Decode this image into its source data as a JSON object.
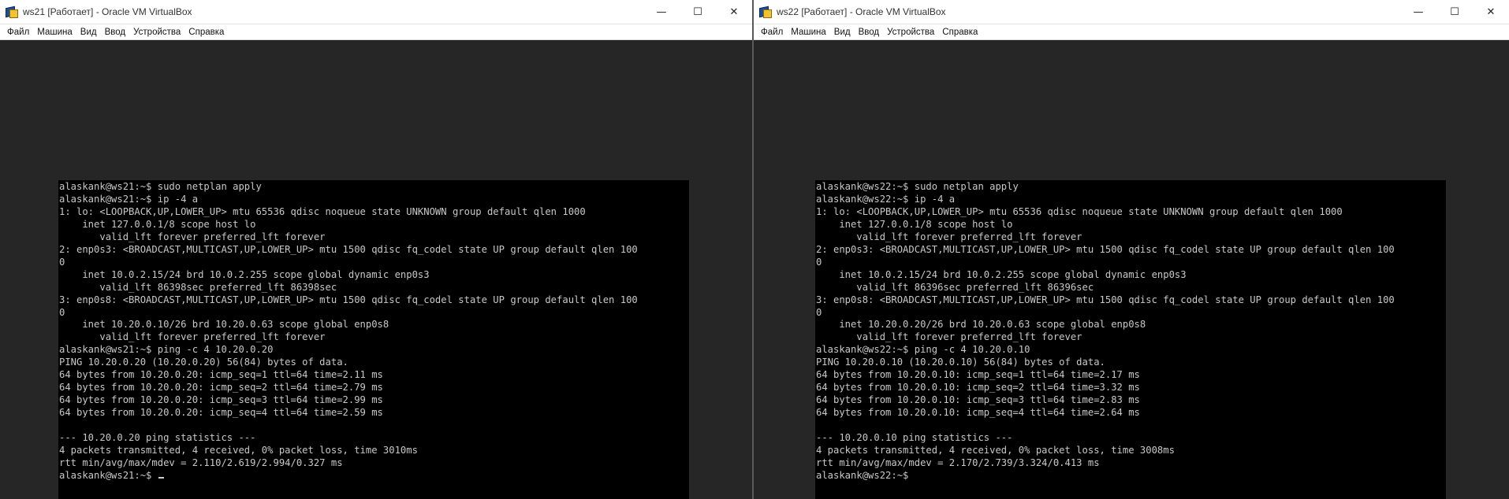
{
  "vms": [
    {
      "title": "ws21 [Работает] - Oracle VM VirtualBox",
      "menu": [
        "Файл",
        "Машина",
        "Вид",
        "Ввод",
        "Устройства",
        "Справка"
      ],
      "controls": {
        "minimize": "—",
        "maximize": "☐",
        "close": "✕"
      },
      "console_text": "alaskank@ws21:~$ sudo netplan apply\nalaskank@ws21:~$ ip -4 a\n1: lo: <LOOPBACK,UP,LOWER_UP> mtu 65536 qdisc noqueue state UNKNOWN group default qlen 1000\n    inet 127.0.0.1/8 scope host lo\n       valid_lft forever preferred_lft forever\n2: enp0s3: <BROADCAST,MULTICAST,UP,LOWER_UP> mtu 1500 qdisc fq_codel state UP group default qlen 100\n0\n    inet 10.0.2.15/24 brd 10.0.2.255 scope global dynamic enp0s3\n       valid_lft 86398sec preferred_lft 86398sec\n3: enp0s8: <BROADCAST,MULTICAST,UP,LOWER_UP> mtu 1500 qdisc fq_codel state UP group default qlen 100\n0\n    inet 10.20.0.10/26 brd 10.20.0.63 scope global enp0s8\n       valid_lft forever preferred_lft forever\nalaskank@ws21:~$ ping -c 4 10.20.0.20\nPING 10.20.0.20 (10.20.0.20) 56(84) bytes of data.\n64 bytes from 10.20.0.20: icmp_seq=1 ttl=64 time=2.11 ms\n64 bytes from 10.20.0.20: icmp_seq=2 ttl=64 time=2.79 ms\n64 bytes from 10.20.0.20: icmp_seq=3 ttl=64 time=2.99 ms\n64 bytes from 10.20.0.20: icmp_seq=4 ttl=64 time=2.59 ms\n\n--- 10.20.0.20 ping statistics ---\n4 packets transmitted, 4 received, 0% packet loss, time 3010ms\nrtt min/avg/max/mdev = 2.110/2.619/2.994/0.327 ms\n",
      "prompt": "alaskank@ws21:~$ ",
      "show_cursor": true
    },
    {
      "title": "ws22 [Работает] - Oracle VM VirtualBox",
      "menu": [
        "Файл",
        "Машина",
        "Вид",
        "Ввод",
        "Устройства",
        "Справка"
      ],
      "controls": {
        "minimize": "—",
        "maximize": "☐",
        "close": "✕"
      },
      "console_text": "alaskank@ws22:~$ sudo netplan apply\nalaskank@ws22:~$ ip -4 a\n1: lo: <LOOPBACK,UP,LOWER_UP> mtu 65536 qdisc noqueue state UNKNOWN group default qlen 1000\n    inet 127.0.0.1/8 scope host lo\n       valid_lft forever preferred_lft forever\n2: enp0s3: <BROADCAST,MULTICAST,UP,LOWER_UP> mtu 1500 qdisc fq_codel state UP group default qlen 100\n0\n    inet 10.0.2.15/24 brd 10.0.2.255 scope global dynamic enp0s3\n       valid_lft 86396sec preferred_lft 86396sec\n3: enp0s8: <BROADCAST,MULTICAST,UP,LOWER_UP> mtu 1500 qdisc fq_codel state UP group default qlen 100\n0\n    inet 10.20.0.20/26 brd 10.20.0.63 scope global enp0s8\n       valid_lft forever preferred_lft forever\nalaskank@ws22:~$ ping -c 4 10.20.0.10\nPING 10.20.0.10 (10.20.0.10) 56(84) bytes of data.\n64 bytes from 10.20.0.10: icmp_seq=1 ttl=64 time=2.17 ms\n64 bytes from 10.20.0.10: icmp_seq=2 ttl=64 time=3.32 ms\n64 bytes from 10.20.0.10: icmp_seq=3 ttl=64 time=2.83 ms\n64 bytes from 10.20.0.10: icmp_seq=4 ttl=64 time=2.64 ms\n\n--- 10.20.0.10 ping statistics ---\n4 packets transmitted, 4 received, 0% packet loss, time 3008ms\nrtt min/avg/max/mdev = 2.170/2.739/3.324/0.413 ms\n",
      "prompt": "alaskank@ws22:~$",
      "show_cursor": false
    }
  ]
}
